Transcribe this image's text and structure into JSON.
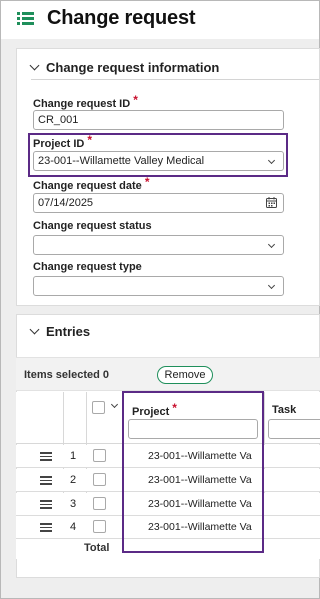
{
  "header": {
    "title": "Change request",
    "menu_icon": "list-menu-icon"
  },
  "info_section": {
    "heading": "Change request information",
    "fields": {
      "change_request_id": {
        "label": "Change request ID",
        "value": "CR_001",
        "required": "*"
      },
      "project_id": {
        "label": "Project ID",
        "value": "23-001--Willamette Valley Medical",
        "required": "*"
      },
      "change_request_date": {
        "label": "Change request date",
        "value": "07/14/2025",
        "required": "*"
      },
      "change_request_status": {
        "label": "Change request status",
        "value": ""
      },
      "change_request_type": {
        "label": "Change request type",
        "value": ""
      }
    }
  },
  "entries_section": {
    "heading": "Entries",
    "items_selected": "Items selected 0",
    "remove_label": "Remove",
    "columns": {
      "project": "Project",
      "project_required": "*",
      "task": "Task"
    },
    "rows": [
      {
        "num": "1",
        "project": "23-001--Willamette Va"
      },
      {
        "num": "2",
        "project": "23-001--Willamette Va"
      },
      {
        "num": "3",
        "project": "23-001--Willamette Va"
      },
      {
        "num": "4",
        "project": "23-001--Willamette Va"
      }
    ],
    "total_label": "Total"
  },
  "colors": {
    "accent": "#1f8f5b",
    "highlight": "#5b2a86",
    "required": "#c8102e"
  }
}
